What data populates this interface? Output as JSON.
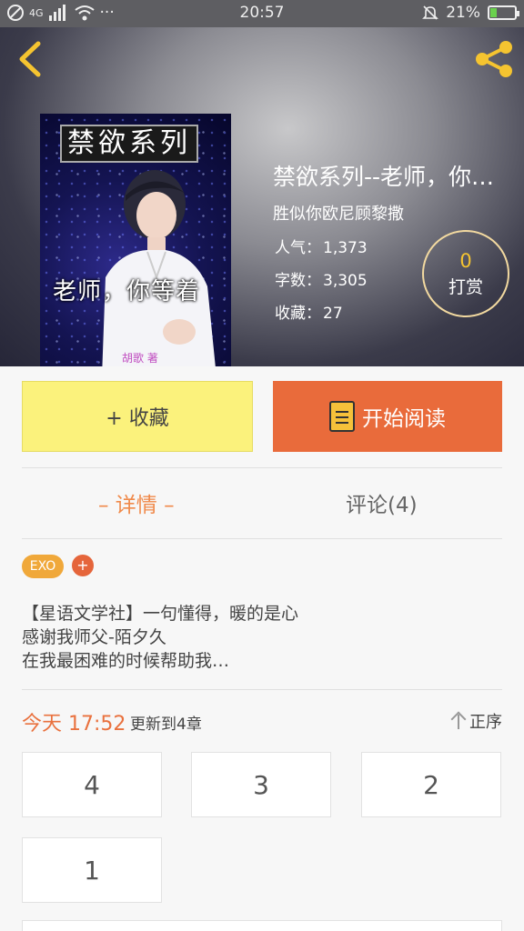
{
  "status_bar": {
    "network": "4G",
    "time": "20:57",
    "battery": "21%",
    "more": "···"
  },
  "book": {
    "title": "禁欲系列--老师，你等着",
    "author": "胜似你欧尼顾黎撒",
    "cover": {
      "title": "禁欲系列",
      "subtitle": "老师，你等着",
      "mark": "胡歌 著"
    },
    "popularity_label": "人气：",
    "popularity": "1,373",
    "words_label": "字数：",
    "words": "3,305",
    "favorites_label": "收藏：",
    "favorites": "27"
  },
  "tip": {
    "count": "0",
    "label": "打赏"
  },
  "actions": {
    "collect": "+ 收藏",
    "read": "开始阅读"
  },
  "tabs": {
    "details": "– 详情 –",
    "comments": "评论(4)"
  },
  "tags": [
    {
      "label": "EXO"
    }
  ],
  "tag_add": "+",
  "description": [
    "【星语文学社】一句懂得，暖的是心",
    "感谢我师父-陌夕久",
    "在我最困难的时候帮助我…"
  ],
  "update": {
    "time": "今天 17:52",
    "text": "更新到4章",
    "sort": "正序"
  },
  "chapters": [
    "4",
    "3",
    "2",
    "1"
  ],
  "colors": {
    "accent": "#e96b3b",
    "collect_bg": "#fbf27c",
    "tab_active": "#f08a4b",
    "tip_count": "#f5c430"
  },
  "icons": {
    "back": "chevron-left-icon",
    "share": "share-icon",
    "read": "book-icon",
    "sort": "arrow-up-icon"
  }
}
